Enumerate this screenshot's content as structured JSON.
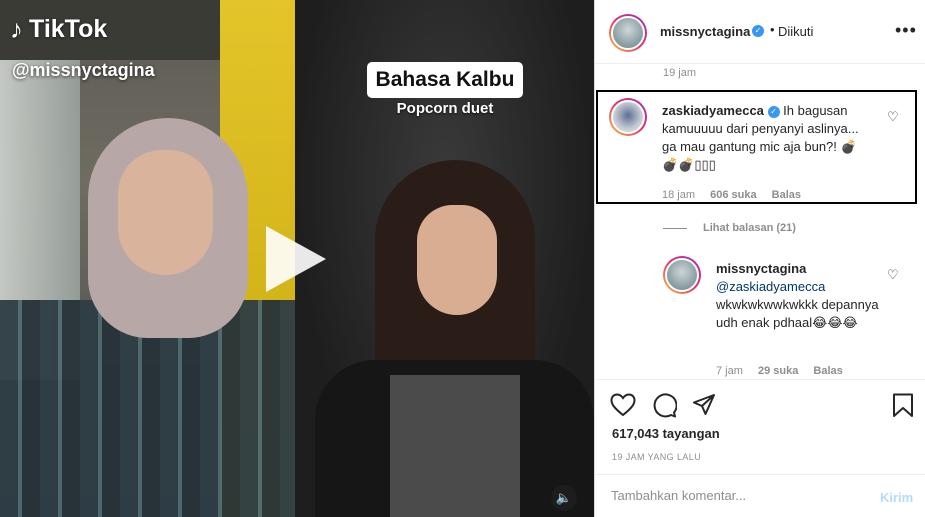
{
  "video": {
    "tiktok_brand": "TikTok",
    "tiktok_user": "@missnyctagina",
    "song_title": "Bahasa Kalbu",
    "song_subtitle": "Popcorn duet"
  },
  "header": {
    "username": "missnyctagina",
    "separator": "•",
    "follow_status": "Diikuti",
    "more_icon": "more-horizontal-icon"
  },
  "comments": {
    "top_timestamp": "19 jam",
    "highlighted": {
      "username": "zaskiadyamecca",
      "text": "Ih bagusan kamuuuuu dari penyanyi aslinya... ga mau gantung mic aja bun?! 💣💣💣▯▯▯",
      "time": "18 jam",
      "likes": "606 suka",
      "reply": "Balas"
    },
    "view_replies": "Lihat balasan (21)",
    "reply": {
      "username": "missnyctagina",
      "mention": "@zaskiadyamecca",
      "text": "wkwkwkwwkwkkk depannya udh enak pdhaal😂😂😂",
      "time": "7 jam",
      "likes": "29 suka",
      "reply": "Balas"
    }
  },
  "actions": {
    "views": "617,043 tayangan",
    "posted": "19 JAM YANG LALU"
  },
  "add_comment": {
    "placeholder": "Tambahkan komentar...",
    "post_label": "Kirim"
  },
  "colors": {
    "link": "#00376b",
    "verified": "#3897f0",
    "secondary_text": "#8e8e8e",
    "post_disabled": "#b3dbff"
  }
}
